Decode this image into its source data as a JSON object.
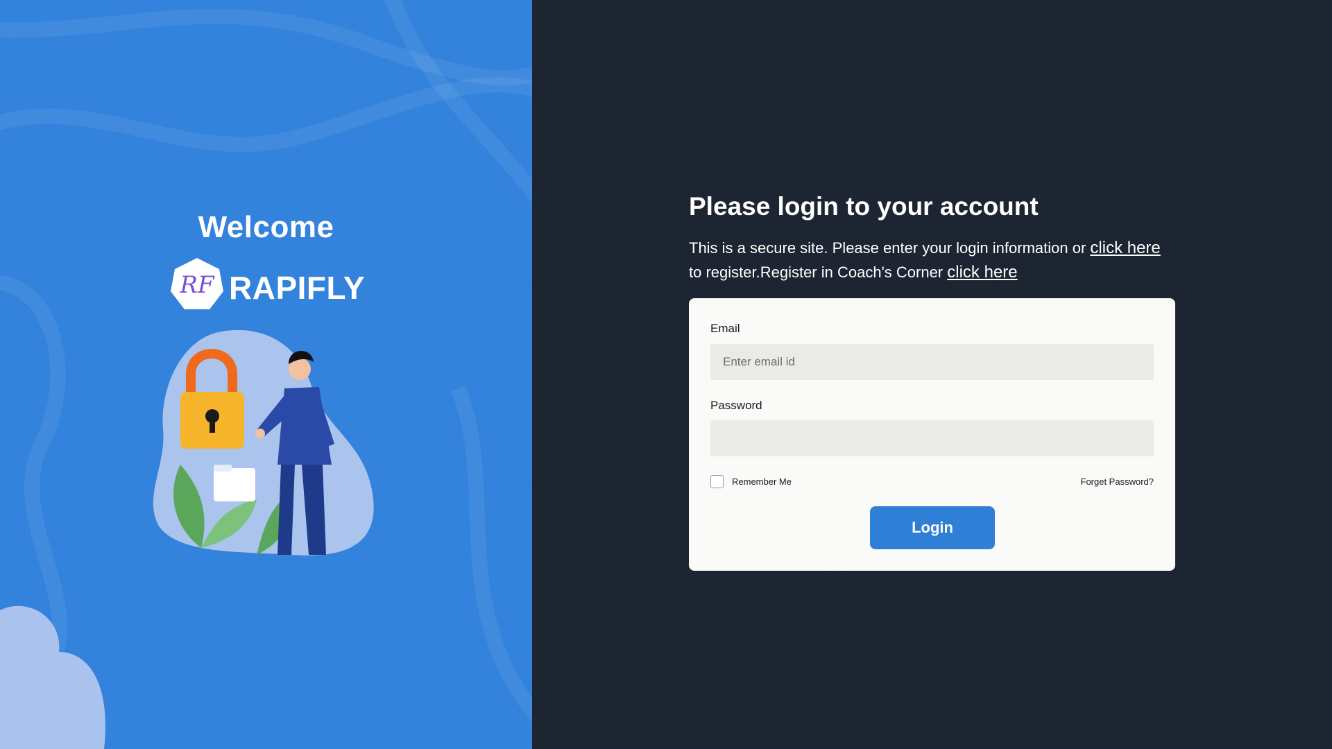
{
  "colors": {
    "left_panel": "#3383dc",
    "right_panel": "#1b2330",
    "card": "#fafaf8",
    "input_bg": "#eaeae7",
    "button": "#2f7fd6"
  },
  "left": {
    "welcome": "Welcome",
    "brand_name": "RAPIFLY",
    "logo_text": "RF",
    "illustration": "person-with-padlock-illustration"
  },
  "right": {
    "heading": "Please login to your account",
    "intro_part1": "This is a secure site. Please enter your login information or",
    "link_register": "click here",
    "intro_part2": "to register.Register in Coach's Corner",
    "link_coach": "click here"
  },
  "form": {
    "email_label": "Email",
    "email_placeholder": "Enter email id",
    "email_value": "",
    "password_label": "Password",
    "password_value": "",
    "remember_label": "Remember Me",
    "remember_checked": false,
    "forgot_label": "Forget Password?",
    "login_label": "Login"
  }
}
